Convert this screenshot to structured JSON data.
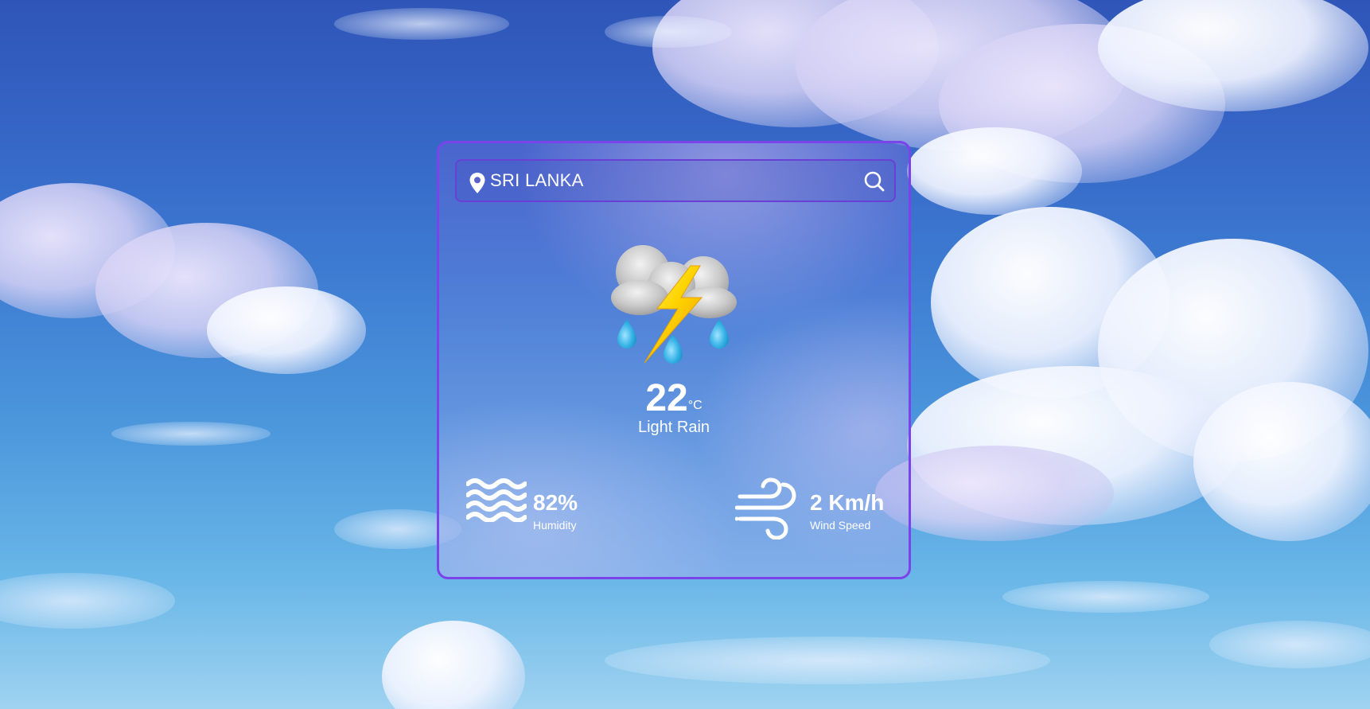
{
  "search": {
    "location_value": "SRI LANKA",
    "location_icon": "map-pin-icon",
    "search_icon": "search-icon"
  },
  "weather": {
    "icon": "thunderstorm-rain-icon",
    "temperature": "22",
    "temperature_unit": "°C",
    "condition": "Light Rain"
  },
  "stats": {
    "humidity": {
      "icon": "water-waves-icon",
      "value": "82%",
      "label": "Humidity"
    },
    "wind": {
      "icon": "wind-icon",
      "value": "2 Km/h",
      "label": "Wind Speed"
    }
  },
  "colors": {
    "card_border": "#7a44ea",
    "search_border": "#6a3fd6",
    "text": "#ffffff",
    "sky_top": "#2f55b8",
    "sky_bottom": "#9fd3f0"
  }
}
